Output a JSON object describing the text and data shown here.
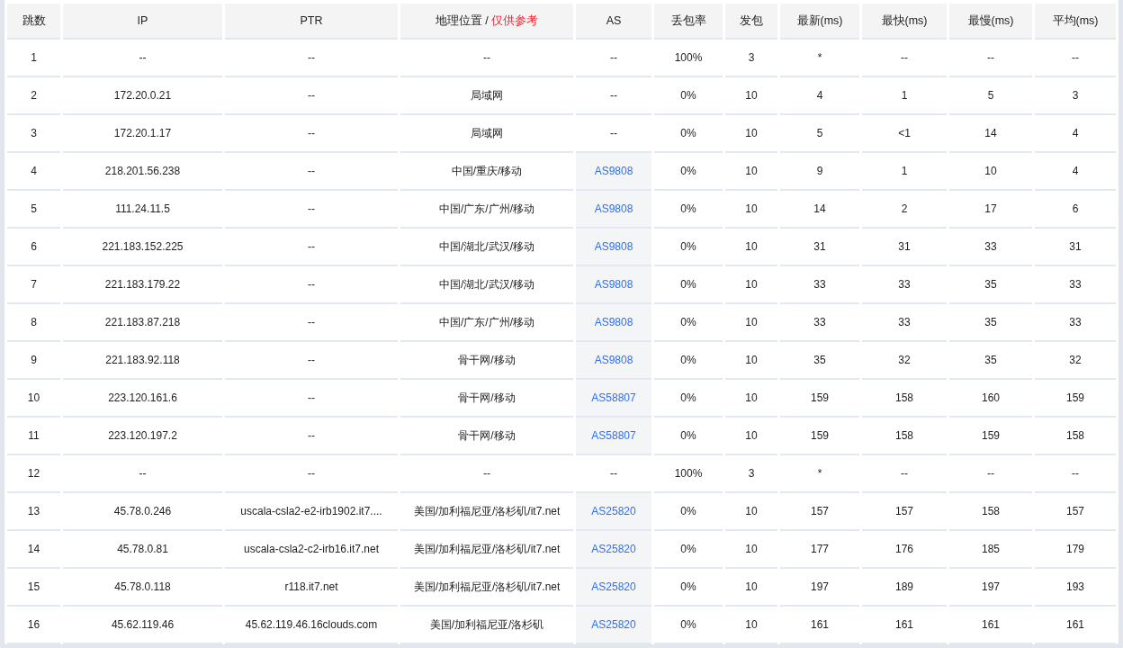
{
  "table": {
    "columns": [
      {
        "label": "跳数"
      },
      {
        "label": "IP"
      },
      {
        "label": "PTR"
      },
      {
        "label": "地理位置 /",
        "note": "仅供参考"
      },
      {
        "label": "AS"
      },
      {
        "label": "丢包率"
      },
      {
        "label": "发包"
      },
      {
        "label": "最新(ms)"
      },
      {
        "label": "最快(ms)"
      },
      {
        "label": "最慢(ms)"
      },
      {
        "label": "平均(ms)"
      }
    ],
    "rows": [
      {
        "hop": "1",
        "ip": "--",
        "ptr": "--",
        "geo": "--",
        "as": {
          "text": "--",
          "linked": false
        },
        "loss": "100%",
        "sent": "3",
        "last": "*",
        "best": "--",
        "worst": "--",
        "avg": "--"
      },
      {
        "hop": "2",
        "ip": "172.20.0.21",
        "ptr": "--",
        "geo": "局域网",
        "as": {
          "text": "--",
          "linked": false
        },
        "loss": "0%",
        "sent": "10",
        "last": "4",
        "best": "1",
        "worst": "5",
        "avg": "3"
      },
      {
        "hop": "3",
        "ip": "172.20.1.17",
        "ptr": "--",
        "geo": "局域网",
        "as": {
          "text": "--",
          "linked": false
        },
        "loss": "0%",
        "sent": "10",
        "last": "5",
        "best": "<1",
        "worst": "14",
        "avg": "4"
      },
      {
        "hop": "4",
        "ip": "218.201.56.238",
        "ptr": "--",
        "geo": "中国/重庆/移动",
        "as": {
          "text": "AS9808",
          "linked": true
        },
        "loss": "0%",
        "sent": "10",
        "last": "9",
        "best": "1",
        "worst": "10",
        "avg": "4"
      },
      {
        "hop": "5",
        "ip": "111.24.11.5",
        "ptr": "--",
        "geo": "中国/广东/广州/移动",
        "as": {
          "text": "AS9808",
          "linked": true
        },
        "loss": "0%",
        "sent": "10",
        "last": "14",
        "best": "2",
        "worst": "17",
        "avg": "6"
      },
      {
        "hop": "6",
        "ip": "221.183.152.225",
        "ptr": "--",
        "geo": "中国/湖北/武汉/移动",
        "as": {
          "text": "AS9808",
          "linked": true
        },
        "loss": "0%",
        "sent": "10",
        "last": "31",
        "best": "31",
        "worst": "33",
        "avg": "31"
      },
      {
        "hop": "7",
        "ip": "221.183.179.22",
        "ptr": "--",
        "geo": "中国/湖北/武汉/移动",
        "as": {
          "text": "AS9808",
          "linked": true
        },
        "loss": "0%",
        "sent": "10",
        "last": "33",
        "best": "33",
        "worst": "35",
        "avg": "33"
      },
      {
        "hop": "8",
        "ip": "221.183.87.218",
        "ptr": "--",
        "geo": "中国/广东/广州/移动",
        "as": {
          "text": "AS9808",
          "linked": true
        },
        "loss": "0%",
        "sent": "10",
        "last": "33",
        "best": "33",
        "worst": "35",
        "avg": "33"
      },
      {
        "hop": "9",
        "ip": "221.183.92.118",
        "ptr": "--",
        "geo": "骨干网/移动",
        "as": {
          "text": "AS9808",
          "linked": true
        },
        "loss": "0%",
        "sent": "10",
        "last": "35",
        "best": "32",
        "worst": "35",
        "avg": "32"
      },
      {
        "hop": "10",
        "ip": "223.120.161.6",
        "ptr": "--",
        "geo": "骨干网/移动",
        "as": {
          "text": "AS58807",
          "linked": true
        },
        "loss": "0%",
        "sent": "10",
        "last": "159",
        "best": "158",
        "worst": "160",
        "avg": "159"
      },
      {
        "hop": "11",
        "ip": "223.120.197.2",
        "ptr": "--",
        "geo": "骨干网/移动",
        "as": {
          "text": "AS58807",
          "linked": true
        },
        "loss": "0%",
        "sent": "10",
        "last": "159",
        "best": "158",
        "worst": "159",
        "avg": "158"
      },
      {
        "hop": "12",
        "ip": "--",
        "ptr": "--",
        "geo": "--",
        "as": {
          "text": "--",
          "linked": false
        },
        "loss": "100%",
        "sent": "3",
        "last": "*",
        "best": "--",
        "worst": "--",
        "avg": "--"
      },
      {
        "hop": "13",
        "ip": "45.78.0.246",
        "ptr": "uscala-csla2-e2-irb1902.it7....",
        "geo": "美国/加利福尼亚/洛杉矶/it7.net",
        "as": {
          "text": "AS25820",
          "linked": true
        },
        "loss": "0%",
        "sent": "10",
        "last": "157",
        "best": "157",
        "worst": "158",
        "avg": "157"
      },
      {
        "hop": "14",
        "ip": "45.78.0.81",
        "ptr": "uscala-csla2-c2-irb16.it7.net",
        "geo": "美国/加利福尼亚/洛杉矶/it7.net",
        "as": {
          "text": "AS25820",
          "linked": true
        },
        "loss": "0%",
        "sent": "10",
        "last": "177",
        "best": "176",
        "worst": "185",
        "avg": "179"
      },
      {
        "hop": "15",
        "ip": "45.78.0.118",
        "ptr": "r118.it7.net",
        "geo": "美国/加利福尼亚/洛杉矶/it7.net",
        "as": {
          "text": "AS25820",
          "linked": true
        },
        "loss": "0%",
        "sent": "10",
        "last": "197",
        "best": "189",
        "worst": "197",
        "avg": "193"
      },
      {
        "hop": "16",
        "ip": "45.62.119.46",
        "ptr": "45.62.119.46.16clouds.com",
        "geo": "美国/加利福尼亚/洛杉矶",
        "as": {
          "text": "AS25820",
          "linked": true
        },
        "loss": "0%",
        "sent": "10",
        "last": "161",
        "best": "161",
        "worst": "161",
        "avg": "161"
      }
    ]
  }
}
